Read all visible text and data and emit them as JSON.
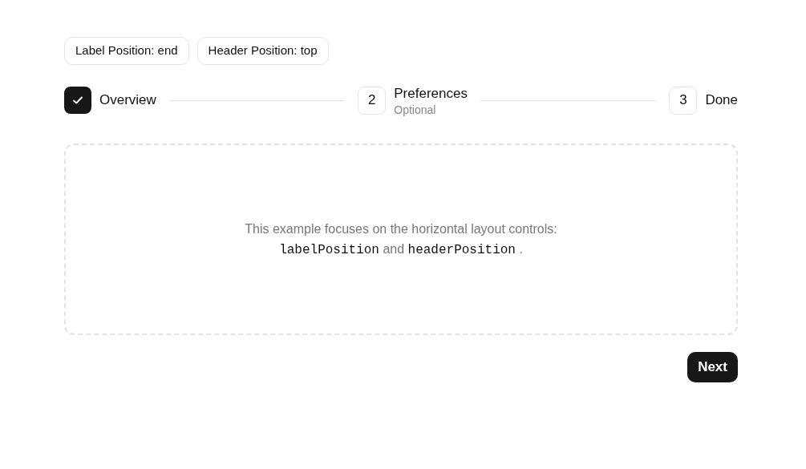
{
  "toggles": [
    {
      "label": "Label Position: end"
    },
    {
      "label": "Header Position: top"
    }
  ],
  "steps": [
    {
      "completed": true,
      "title": "Overview"
    },
    {
      "marker": "2",
      "completed": false,
      "title": "Preferences",
      "subtitle": "Optional"
    },
    {
      "marker": "3",
      "completed": false,
      "title": "Done"
    }
  ],
  "content": {
    "description": [
      {
        "kind": "text",
        "text": "This example focuses on the horizontal layout controls: "
      },
      {
        "kind": "code",
        "text": "labelPosition"
      },
      {
        "kind": "text",
        "text": " and "
      },
      {
        "kind": "code",
        "text": "headerPosition"
      },
      {
        "kind": "text",
        "text": " ."
      }
    ]
  },
  "next_button": "Next"
}
